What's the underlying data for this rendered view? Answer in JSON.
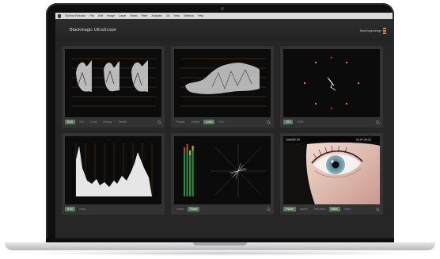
{
  "menubar": {
    "items": [
      "DaVinci Resolve",
      "File",
      "Edit",
      "Image",
      "Layer",
      "Video",
      "Filter",
      "Analysis",
      "3D",
      "View",
      "Window",
      "Help"
    ]
  },
  "app": {
    "title": "Blackmagic UltraScope",
    "brand": "Blackmagicdesign",
    "accent": "#5d7d62",
    "brand_color": "#d8843a"
  },
  "panels": {
    "waveform": {
      "controls": [
        "RGB",
        "YUV",
        "Luma",
        "Overlay",
        "Parade"
      ],
      "active": 0
    },
    "lumawave": {
      "controls": [
        "Parade",
        "Overlay",
        "Luma",
        "YUV"
      ],
      "active": 2
    },
    "vectorscope": {
      "controls": [
        "75%",
        "100%"
      ],
      "active": 0
    },
    "histogram": {
      "controls": [
        "RGB",
        "Luma"
      ],
      "active": 0
    },
    "audio": {
      "controls": [
        "Levels",
        "Phase"
      ],
      "active": 1
    },
    "picture": {
      "controls": [
        "Picture",
        "Aspect",
        "Safe Area",
        "Blank",
        "Zoom"
      ],
      "active": [
        0,
        3
      ],
      "source": "1080i59.94",
      "timecode": "01:07:34:12"
    }
  }
}
